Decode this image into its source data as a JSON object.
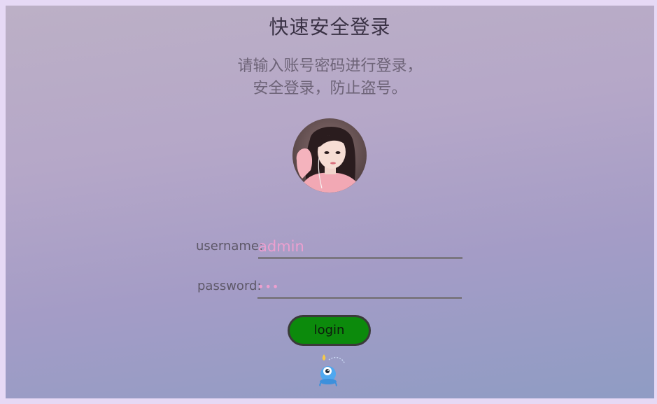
{
  "header": {
    "title": "快速安全登录",
    "subtitle_line1": "请输入账号密码进行登录，",
    "subtitle_line2": "安全登录，防止盗号。"
  },
  "avatar": {
    "icon": "user-avatar-photo"
  },
  "form": {
    "username_label": "username:",
    "username_value": "admin",
    "password_label": "password:",
    "password_value": "•••"
  },
  "actions": {
    "login_label": "login"
  },
  "mascot": {
    "icon": "mascot-cartoon-icon"
  },
  "colors": {
    "input_text": "#ec9fcf",
    "button_bg": "#0c8a0c",
    "title_text": "#3a3245"
  }
}
